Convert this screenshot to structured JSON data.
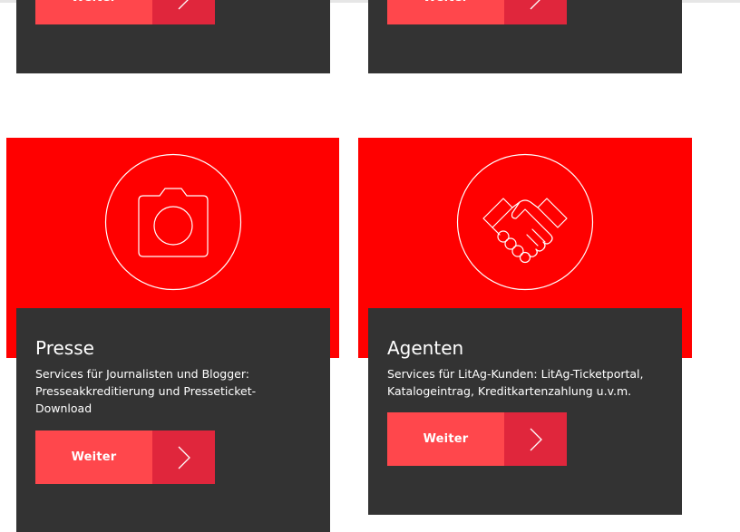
{
  "colors": {
    "card_dark": "#333333",
    "card_red": "#ff0000",
    "button_label_bg": "#ff474c",
    "button_arrow_bg": "#e0263c",
    "text": "#ffffff"
  },
  "top_cards": [
    {
      "button": {
        "label": "Weiter",
        "icon": "chevron-right-icon"
      }
    },
    {
      "button": {
        "label": "Weiter",
        "icon": "chevron-right-icon"
      }
    }
  ],
  "cards": [
    {
      "icon": "camera-icon",
      "title": "Presse",
      "description": "Services für Journalisten und Blogger: Presseakkreditierung und Presseticket-Download",
      "button": {
        "label": "Weiter",
        "icon": "chevron-right-icon"
      }
    },
    {
      "icon": "handshake-icon",
      "title": "Agenten",
      "description": "Services für LitAg-Kunden: LitAg-Ticketportal, Katalogeintrag, Kreditkartenzahlung u.v.m.",
      "button": {
        "label": "Weiter",
        "icon": "chevron-right-icon"
      }
    }
  ]
}
